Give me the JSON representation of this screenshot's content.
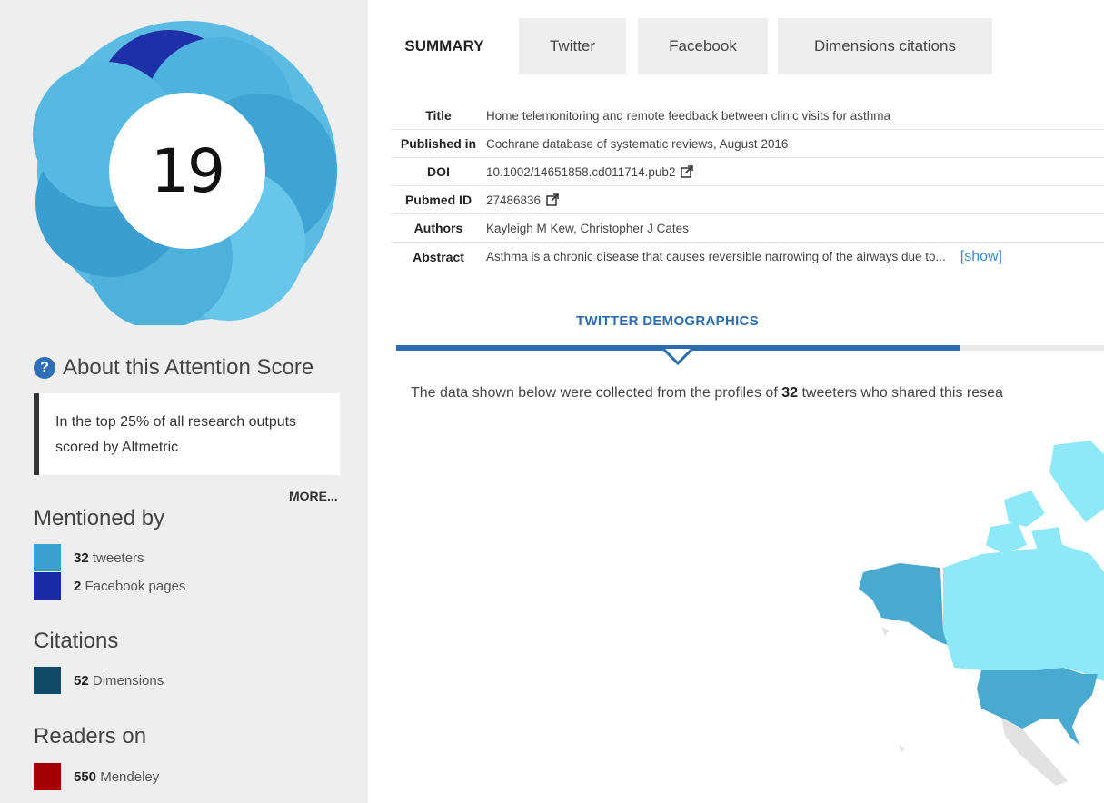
{
  "score": {
    "value": "19",
    "ring_colors": [
      "#6cc4e6",
      "#4fb2de",
      "#3a9fd0",
      "#1e2fa8"
    ]
  },
  "about": {
    "icon": "question-icon",
    "heading": "About this Attention Score",
    "callout": "In the top 25% of all research outputs scored by Altmetric",
    "more": "MORE..."
  },
  "mentioned": {
    "heading": "Mentioned by",
    "items": [
      {
        "count": "32",
        "label": "tweeters",
        "color": "#3aa0cf"
      },
      {
        "count": "2",
        "label": "Facebook pages",
        "color": "#1a2aa2"
      }
    ]
  },
  "citations": {
    "heading": "Citations",
    "items": [
      {
        "count": "52",
        "label": "Dimensions",
        "color": "#0f4b66"
      }
    ]
  },
  "readers": {
    "heading": "Readers on",
    "items": [
      {
        "count": "550",
        "label": "Mendeley",
        "color": "#a10000"
      }
    ]
  },
  "tabs": [
    {
      "label": "SUMMARY",
      "active": true
    },
    {
      "label": "Twitter",
      "active": false
    },
    {
      "label": "Facebook",
      "active": false
    },
    {
      "label": "Dimensions citations",
      "active": false
    }
  ],
  "meta": {
    "title_key": "Title",
    "title_val": "Home telemonitoring and remote feedback between clinic visits for asthma",
    "published_key": "Published in",
    "published_val": "Cochrane database of systematic reviews, August 2016",
    "doi_key": "DOI",
    "doi_val": "10.1002/14651858.cd011714.pub2",
    "pubmed_key": "Pubmed ID",
    "pubmed_val": "27486836",
    "authors_key": "Authors",
    "authors_val": "Kayleigh M Kew, Christopher J Cates",
    "abstract_key": "Abstract",
    "abstract_val": "Asthma is a chronic disease that causes reversible narrowing of the airways due to...",
    "show": "[show]",
    "external_icon": "external-link-icon"
  },
  "demographics": {
    "title": "TWITTER DEMOGRAPHICS",
    "text_before": "The data shown below were collected from the profiles of",
    "count": "32",
    "text_after": "tweeters who shared this resea",
    "map_colors": {
      "high": "#4aa9cf",
      "low": "#8fe8f8",
      "none": "#e2e2e2"
    }
  }
}
